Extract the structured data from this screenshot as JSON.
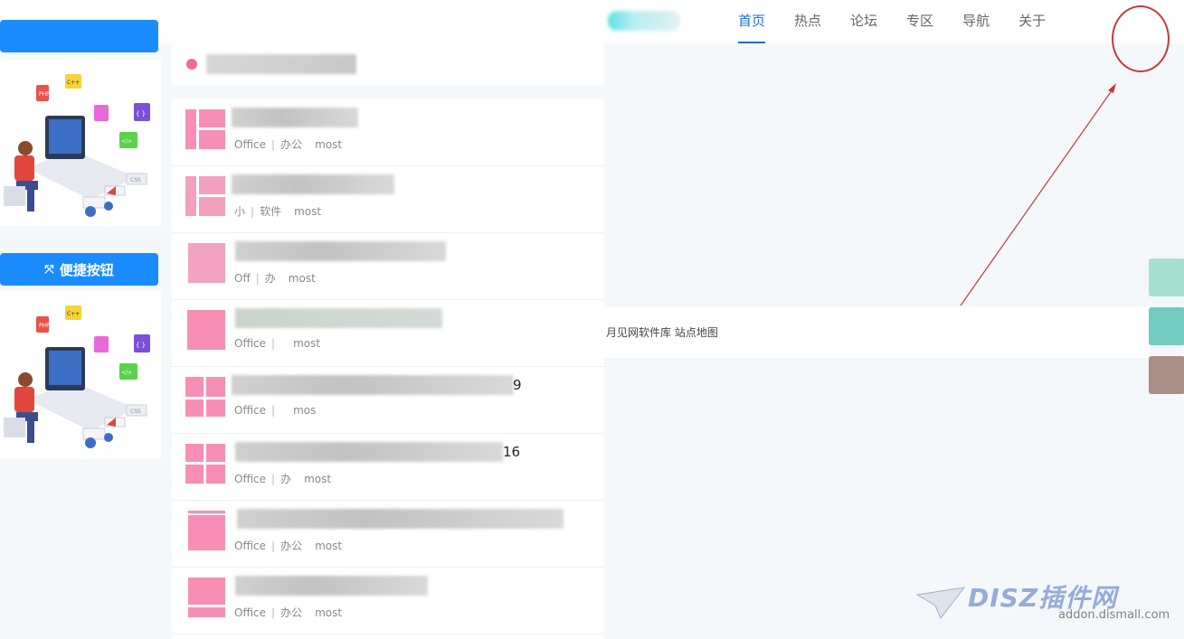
{
  "nav": {
    "items": [
      {
        "label": "首页",
        "active": true
      },
      {
        "label": "热点",
        "active": false
      },
      {
        "label": "论坛",
        "active": false
      },
      {
        "label": "专区",
        "active": false
      },
      {
        "label": "导航",
        "active": false
      },
      {
        "label": "关于",
        "active": false
      }
    ]
  },
  "sidebar": {
    "quick_button_label": "便捷按钮",
    "illustration_labels": [
      "PHP",
      "C++",
      "{ }",
      "</>",
      "CSS"
    ]
  },
  "list": {
    "items": [
      {
        "category": "Office",
        "subcategory": "办公",
        "tag": "most",
        "title_tail": ""
      },
      {
        "category": "小",
        "subcategory": "软件",
        "tag": "most",
        "title_tail": ""
      },
      {
        "category": "Off",
        "subcategory": "办",
        "tag": "most",
        "title_tail": ""
      },
      {
        "category": "Office",
        "subcategory": "",
        "tag": "most",
        "title_tail": ""
      },
      {
        "category": "Office",
        "subcategory": "",
        "tag": "mos",
        "title_tail": "9"
      },
      {
        "category": "Office",
        "subcategory": "办",
        "tag": "most",
        "title_tail": "16"
      },
      {
        "category": "Office",
        "subcategory": "办公",
        "tag": "most",
        "title_tail": ""
      },
      {
        "category": "Office",
        "subcategory": "办公",
        "tag": "most",
        "title_tail": ""
      }
    ]
  },
  "footer": {
    "text": "月见网软件库 站点地图"
  },
  "watermark": {
    "main": "DISZ插件网",
    "url": "addon.dismall.com"
  },
  "colors": {
    "accent": "#1b6fd6",
    "button": "#1a8cff",
    "thumb": "#f78fb5",
    "annotation": "#c43a3a"
  }
}
